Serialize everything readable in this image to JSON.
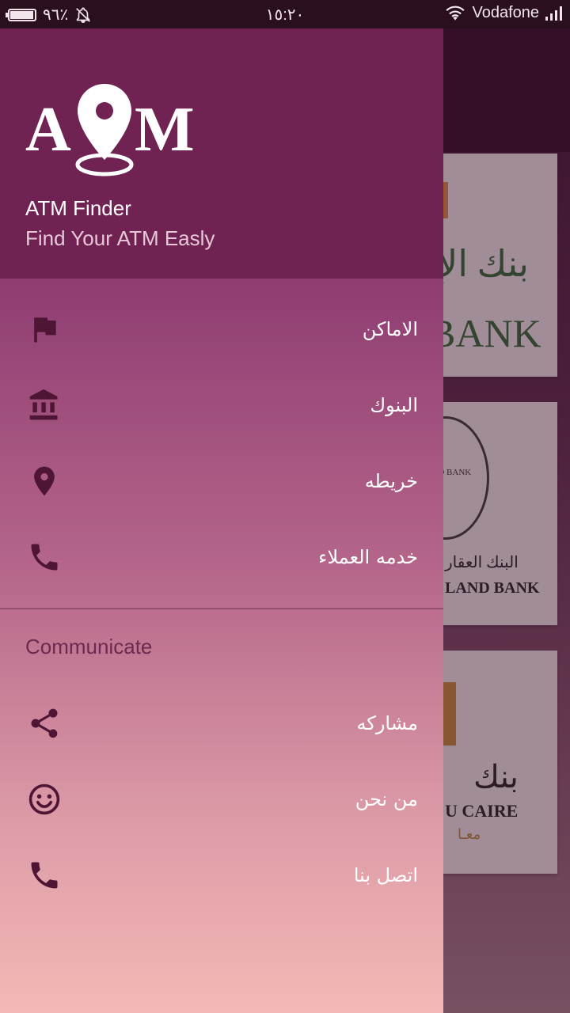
{
  "status_bar": {
    "battery_percent": "٩٦٪",
    "battery_level": 0.96,
    "time": "١٥:٢٠",
    "carrier": "Vodafone",
    "icons": [
      "battery-icon",
      "bell-off-icon",
      "wifi-icon",
      "signal-icon"
    ]
  },
  "background_cards": [
    {
      "arabic": "بنك الإ",
      "english": "BANK"
    },
    {
      "arabic": "البنك العقار",
      "english": "LAND BANK",
      "seal_text": "LAND BANK"
    },
    {
      "arabic": "بنك",
      "english": "U CAIRE",
      "subtitle": "معـا"
    }
  ],
  "drawer": {
    "logo_text": "ATM",
    "app_name": "ATM Finder",
    "tagline": "Find Your ATM Easly",
    "menu_items": [
      {
        "label": "الاماكن",
        "icon": "flag-icon"
      },
      {
        "label": "البنوك",
        "icon": "bank-icon"
      },
      {
        "label": "خريطه",
        "icon": "map-pin-icon"
      },
      {
        "label": "خدمه العملاء",
        "icon": "phone-icon"
      }
    ],
    "section_title": "Communicate",
    "communicate_items": [
      {
        "label": "مشاركه",
        "icon": "share-icon"
      },
      {
        "label": "من نحن",
        "icon": "smiley-icon"
      },
      {
        "label": "اتصل بنا",
        "icon": "phone-icon"
      }
    ]
  },
  "colors": {
    "header": "#702352",
    "drawer_top": "#7a2563",
    "drawer_bottom": "#f4b9b6",
    "icon": "#4e1634",
    "section_label": "#6c2a4e"
  }
}
